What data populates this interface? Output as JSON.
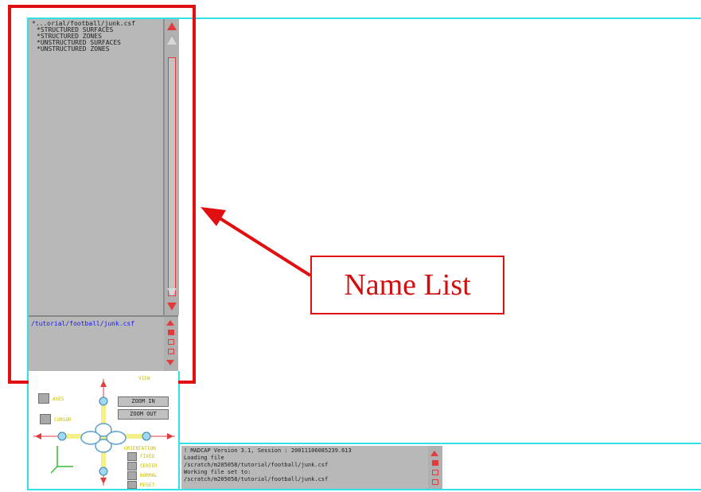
{
  "name_list": {
    "rows": [
      "*...orial/football/junk.csf",
      "*STRUCTURED SURFACES",
      "*STRUCTURED ZONES",
      "*UNSTRUCTURED SURFACES",
      "*UNSTRUCTURED ZONES"
    ],
    "path_text": "/tutorial/football/junk.csf"
  },
  "controls": {
    "checkbox_1_label": "AXES",
    "checkbox_2_label": "CURSOR",
    "zoom_in_label": "ZOOM IN",
    "zoom_out_label": "ZOOM OUT",
    "view_label": "VIEW",
    "orient_label": "ORIENTATION",
    "opt_1": "FIXED",
    "opt_2": "CENTER",
    "opt_3": "NORMAL",
    "opt_4": "RESET"
  },
  "console": {
    "lines": [
      "! MADCAP Version 3.1, Session : 20011106085239.613",
      "Loading file",
      "/scratch/m205058/tutorial/football/junk.csf",
      "Working file set to:",
      "/scratch/m205058/tutorial/football/junk.csf"
    ]
  },
  "callout": {
    "label": "Name List"
  },
  "colors": {
    "highlight": "#e01010",
    "frame": "#33e0e8",
    "panel_gray": "#b8b8b8",
    "link_blue": "#1a1af0"
  }
}
